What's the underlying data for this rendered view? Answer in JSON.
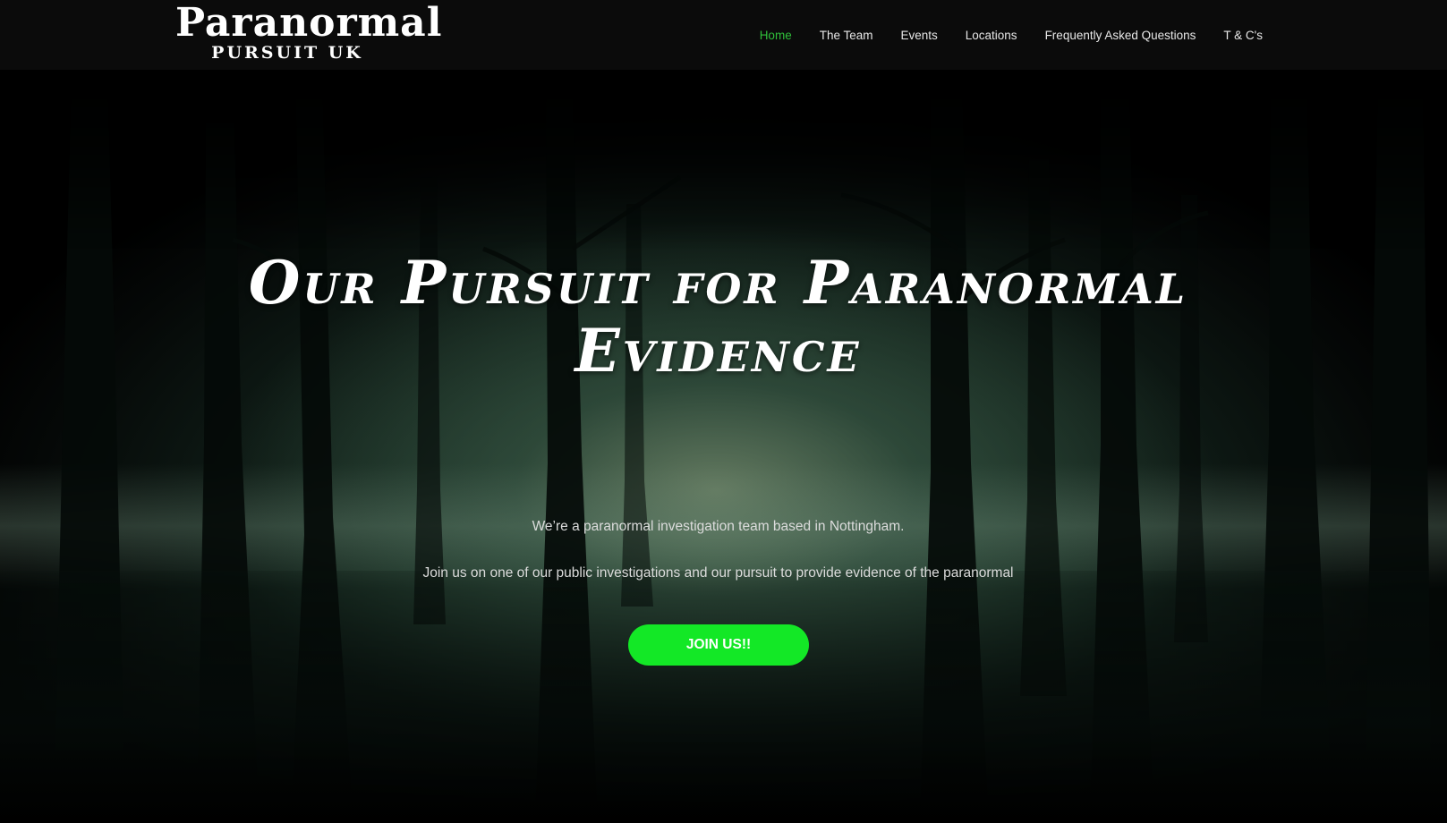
{
  "header": {
    "logo": {
      "main": "Paranormal",
      "sub": "PURSUIT UK"
    },
    "nav": [
      {
        "label": "Home",
        "active": true
      },
      {
        "label": "The Team",
        "active": false
      },
      {
        "label": "Events",
        "active": false
      },
      {
        "label": "Locations",
        "active": false
      },
      {
        "label": "Frequently Asked Questions",
        "active": false
      },
      {
        "label": "T & C's",
        "active": false
      }
    ]
  },
  "hero": {
    "headline_line1": "Our Pursuit for Paranormal",
    "headline_line2": "Evidence",
    "tagline_1": "We’re a paranormal investigation team based in Nottingham.",
    "tagline_2": "Join us on one of our public investigations and our pursuit to provide evidence of the paranormal",
    "cta_label": "JOIN US!!"
  },
  "colors": {
    "header_bg": "#0b0b0b",
    "nav_active": "#2fbf3a",
    "nav_text": "#e8e8e8",
    "cta_bg": "#13e826",
    "text_light": "#dcdcdc"
  }
}
